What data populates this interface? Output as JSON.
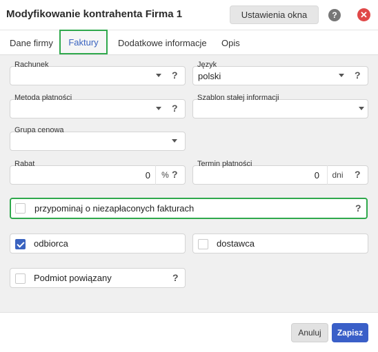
{
  "window": {
    "title": "Modyfikowanie kontrahenta Firma 1",
    "settings_label": "Ustawienia okna",
    "help_glyph": "?",
    "close_glyph": "✕"
  },
  "tabs": [
    {
      "label": "Dane firmy"
    },
    {
      "label": "Faktury"
    },
    {
      "label": "Dodatkowe informacje"
    },
    {
      "label": "Opis"
    }
  ],
  "active_tab": "Faktury",
  "form": {
    "rachunek": {
      "label": "Rachunek",
      "value": ""
    },
    "jezyk": {
      "label": "Język",
      "value": "polski"
    },
    "metoda": {
      "label": "Metoda płatności",
      "value": ""
    },
    "szablon": {
      "label": "Szablon stałej informacji",
      "value": ""
    },
    "grupa": {
      "label": "Grupa cenowa",
      "value": ""
    },
    "rabat": {
      "label": "Rabat",
      "value": "0",
      "unit": "%"
    },
    "termin": {
      "label": "Termin płatności",
      "value": "0",
      "unit": "dni"
    },
    "przypominaj": {
      "label": "przypominaj o niezapłaconych fakturach",
      "checked": false
    },
    "odbiorca": {
      "label": "odbiorca",
      "checked": true
    },
    "dostawca": {
      "label": "dostawca",
      "checked": false
    },
    "podmiot": {
      "label": "Podmiot powiązany",
      "checked": false
    }
  },
  "footer": {
    "cancel_label": "Anuluj",
    "save_label": "Zapisz"
  },
  "help_mark": "?",
  "colors": {
    "accent": "#3a63c0",
    "highlight": "#2ea84b",
    "close": "#e04848"
  }
}
